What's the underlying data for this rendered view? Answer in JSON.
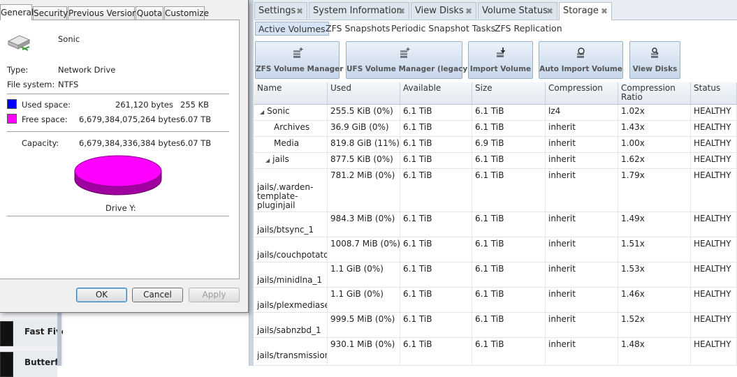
{
  "background_app": {
    "tabs": [
      {
        "label": "Settings"
      },
      {
        "label": "System Information"
      },
      {
        "label": "View Disks"
      },
      {
        "label": "Volume Status"
      },
      {
        "label": "Storage"
      }
    ],
    "tab_close_glyph": "✖",
    "subtabs": [
      {
        "label": "Active Volumes"
      },
      {
        "label": "ZFS Snapshots"
      },
      {
        "label": "Periodic Snapshot Tasks"
      },
      {
        "label": "ZFS Replication"
      }
    ],
    "toolbar": [
      {
        "label": "ZFS Volume Manager",
        "icon": "disk-stack-add-icon"
      },
      {
        "label": "UFS Volume Manager (legacy)",
        "icon": "disk-stack-add-icon"
      },
      {
        "label": "Import Volume",
        "icon": "disk-import-icon"
      },
      {
        "label": "Auto Import Volume",
        "icon": "disk-refresh-icon"
      },
      {
        "label": "View Disks",
        "icon": "disk-search-icon"
      }
    ],
    "columns": [
      "Name",
      "Used",
      "Available",
      "Size",
      "Compression",
      "Compression Ratio",
      "Status"
    ],
    "rows": [
      {
        "name": "Sonic",
        "used": "255.5 KiB (0%)",
        "available": "6.1 TiB",
        "size": "6.1 TiB",
        "compression": "lz4",
        "ratio": "1.02x",
        "status": "HEALTHY"
      },
      {
        "name": "Archives",
        "used": "36.9 GiB (0%)",
        "available": "6.1 TiB",
        "size": "6.1 TiB",
        "compression": "inherit",
        "ratio": "1.43x",
        "status": "HEALTHY"
      },
      {
        "name": "Media",
        "used": "819.8 GiB (11%)",
        "available": "6.1 TiB",
        "size": "6.9 TiB",
        "compression": "inherit",
        "ratio": "1.00x",
        "status": "HEALTHY"
      },
      {
        "name": "jails",
        "used": "877.5 KiB (0%)",
        "available": "6.1 TiB",
        "size": "6.1 TiB",
        "compression": "inherit",
        "ratio": "1.62x",
        "status": "HEALTHY"
      },
      {
        "name": "jails/.warden-template-pluginjail",
        "used": "781.2 MiB (0%)",
        "available": "6.1 TiB",
        "size": "6.1 TiB",
        "compression": "inherit",
        "ratio": "1.79x",
        "status": "HEALTHY"
      },
      {
        "name": "jails/btsync_1",
        "used": "984.3 MiB (0%)",
        "available": "6.1 TiB",
        "size": "6.1 TiB",
        "compression": "inherit",
        "ratio": "1.49x",
        "status": "HEALTHY"
      },
      {
        "name": "jails/couchpotato_",
        "used": "1008.7 MiB (0%)",
        "available": "6.1 TiB",
        "size": "6.1 TiB",
        "compression": "inherit",
        "ratio": "1.51x",
        "status": "HEALTHY"
      },
      {
        "name": "jails/minidlna_1",
        "used": "1.1 GiB (0%)",
        "available": "6.1 TiB",
        "size": "6.1 TiB",
        "compression": "inherit",
        "ratio": "1.53x",
        "status": "HEALTHY"
      },
      {
        "name": "jails/plexmediase",
        "used": "1.1 GiB (0%)",
        "available": "6.1 TiB",
        "size": "6.1 TiB",
        "compression": "inherit",
        "ratio": "1.46x",
        "status": "HEALTHY"
      },
      {
        "name": "jails/sabnzbd_1",
        "used": "999.5 MiB (0%)",
        "available": "6.1 TiB",
        "size": "6.1 TiB",
        "compression": "inherit",
        "ratio": "1.52x",
        "status": "HEALTHY"
      },
      {
        "name": "jails/transmission",
        "used": "930.1 MiB (0%)",
        "available": "6.1 TiB",
        "size": "6.1 TiB",
        "compression": "inherit",
        "ratio": "1.48x",
        "status": "HEALTHY"
      }
    ],
    "left_list": [
      {
        "title": "Fast Five"
      },
      {
        "title": "Butterfl"
      }
    ]
  },
  "dialog": {
    "tabs": [
      {
        "label": "General"
      },
      {
        "label": "Security"
      },
      {
        "label": "Previous Versions"
      },
      {
        "label": "Quota"
      },
      {
        "label": "Customize"
      }
    ],
    "drive_name": "Sonic",
    "type_label": "Type:",
    "type_value": "Network Drive",
    "fs_label": "File system:",
    "fs_value": "NTFS",
    "used_label": "Used space:",
    "used_bytes": "261,120 bytes",
    "used_short": "255 KB",
    "free_label": "Free space:",
    "free_bytes": "6,679,384,075,264 bytes",
    "free_short": "6.07 TB",
    "capacity_label": "Capacity:",
    "capacity_bytes": "6,679,384,336,384 bytes",
    "capacity_short": "6.07 TB",
    "drive_caption": "Drive Y:",
    "used_fraction": 4e-08,
    "colors": {
      "used": "#0000ff",
      "free": "#ff00ff"
    },
    "buttons": {
      "ok": "OK",
      "cancel": "Cancel",
      "apply": "Apply"
    }
  }
}
